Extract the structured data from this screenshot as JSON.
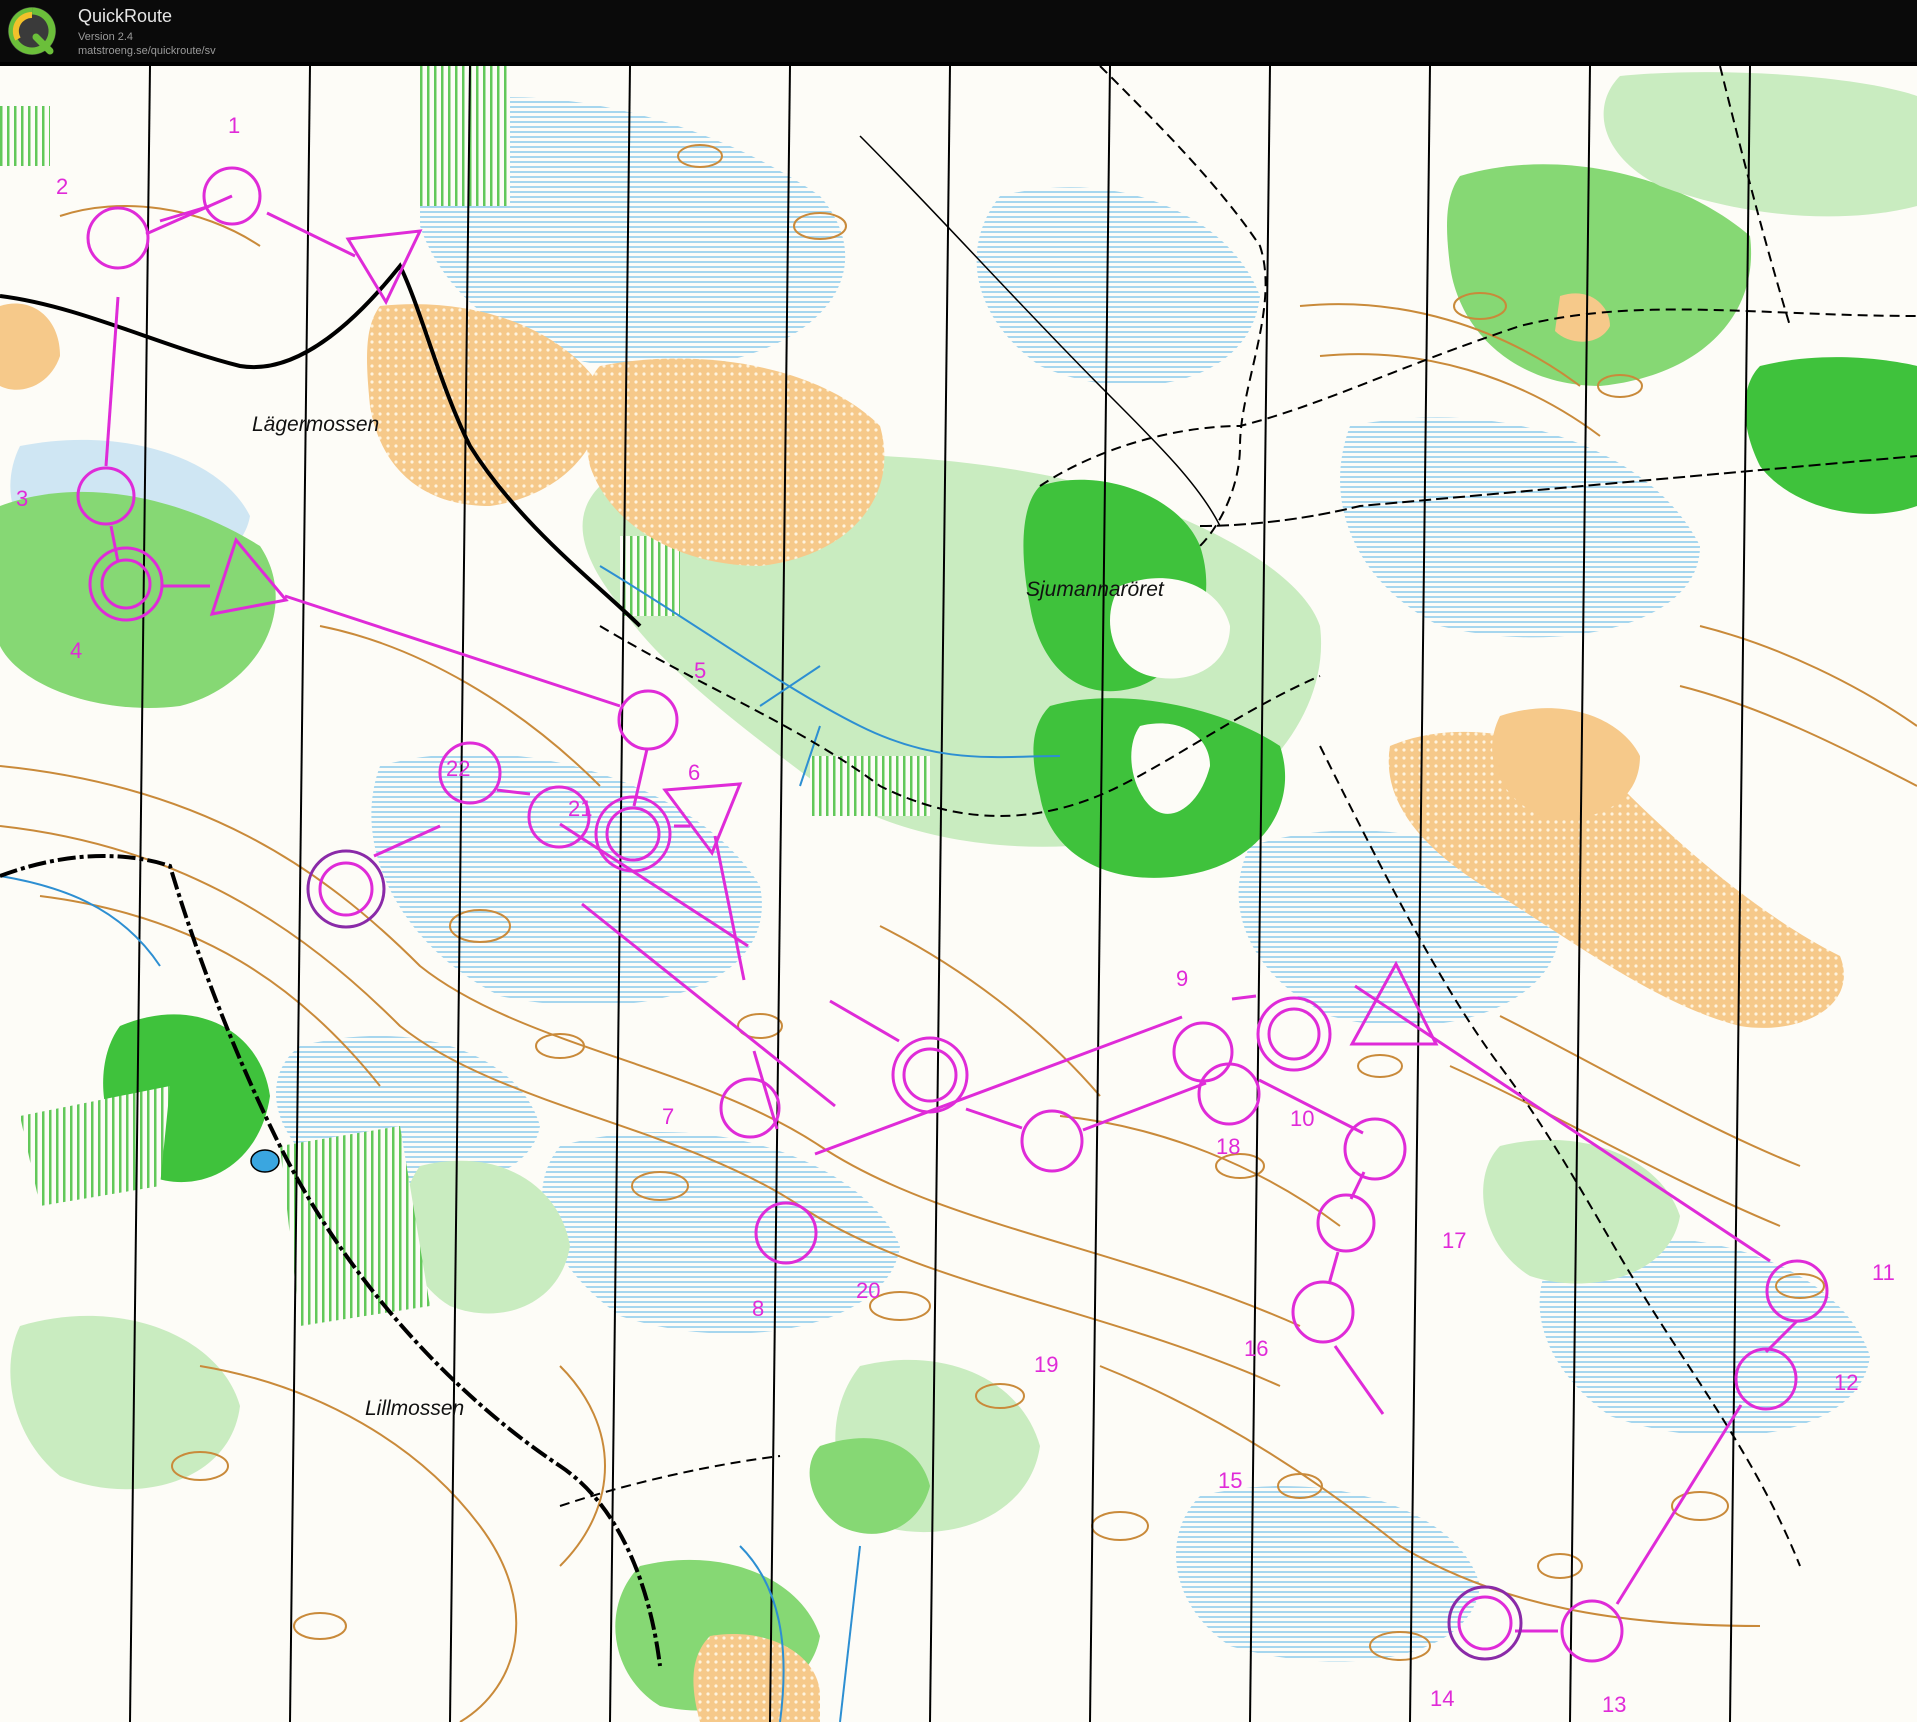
{
  "app": {
    "title": "QuickRoute",
    "version": "Version 2.4",
    "url": "matstroeng.se/quickroute/sv"
  },
  "colors": {
    "course": "#df2bd8",
    "course_dark": "#8a2aa8",
    "paper": "#fdfcf7",
    "forest_light": "#c9ecc0",
    "forest_mid": "#86d874",
    "forest_dark": "#3fc23c",
    "open_yellow": "#f6c98a",
    "contour": "#c98a3a",
    "water_blue": "#b8dcef"
  },
  "map": {
    "place_names": [
      "Lägermossen",
      "Sjumannaröret",
      "Lillmossen"
    ]
  },
  "course": {
    "controls": [
      "1",
      "2",
      "3",
      "4",
      "5",
      "6",
      "7",
      "8",
      "9",
      "10",
      "11",
      "12",
      "13",
      "14",
      "15",
      "16",
      "17",
      "18",
      "19",
      "20",
      "21",
      "22"
    ]
  }
}
